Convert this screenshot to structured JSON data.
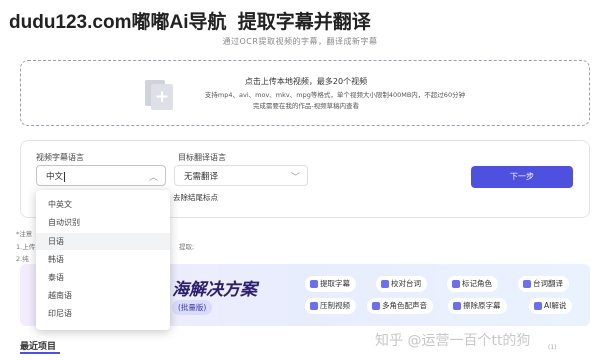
{
  "header": {
    "brand": "dudu123.com嘟嘟Ai导航",
    "title": "提取字幕并翻译",
    "subtitle": "通过OCR提取视频的字幕，翻译成新字幕"
  },
  "upload": {
    "title": "点击上传本地视频，最多20个视频",
    "formats": "支持mp4、avi、mov、mkv、mpg等格式，单个视频大小限制400MB内，不超过60分钟",
    "note": "完成需要在我的作品-视频草稿内查看"
  },
  "settings": {
    "source_label": "视频字幕语言",
    "source_value": "中文",
    "target_label": "目标翻译语言",
    "target_value": "无需翻译",
    "next_button": "下一步",
    "checkbox_label": "去除结尾标点"
  },
  "dropdown": {
    "options": [
      "中英文",
      "自动识别",
      "日语",
      "韩语",
      "泰语",
      "越南语",
      "印尼语"
    ],
    "hovered_index": 2
  },
  "tips": {
    "label": "*注意",
    "line1": "1.上传",
    "line1_tail": "提取;",
    "line2": "2.纯"
  },
  "banner": {
    "title": "海解决方案",
    "tag": "(批量版)",
    "features": [
      "提取字幕",
      "校对台词",
      "标记角色",
      "台词翻译",
      "压制视频",
      "多角色配声音",
      "擦除原字幕",
      "AI解说"
    ]
  },
  "recent": {
    "tab_label": "最近项目"
  },
  "watermark": {
    "text": "知乎 @运营一百个tt的狗",
    "small": "(1)"
  },
  "colors": {
    "accent": "#4e50e0",
    "banner_title": "#2d1f6e"
  }
}
